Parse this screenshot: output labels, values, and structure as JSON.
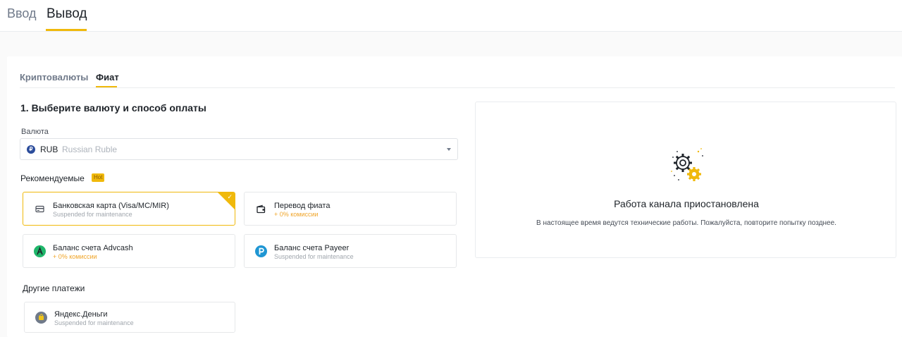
{
  "top_tabs": [
    {
      "label": "Ввод"
    },
    {
      "label": "Вывод"
    }
  ],
  "sub_tabs": [
    {
      "label": "Криптовалюты"
    },
    {
      "label": "Фиат"
    }
  ],
  "step_title": "1. Выберите валюту и способ оплаты",
  "currency": {
    "label": "Валюта",
    "symbol": "₽",
    "code": "RUB",
    "name": "Russian Ruble"
  },
  "recommended": {
    "label": "Рекомендуемые",
    "badge": "Hot",
    "methods": [
      {
        "name": "Банковская карта (Visa/MC/MIR)",
        "desc": "Suspended for maintenance",
        "icon": "bank-card-icon",
        "selected": true
      },
      {
        "name": "Перевод фиата",
        "desc": "+ 0% комиссии",
        "icon": "wallet-icon"
      },
      {
        "name": "Баланс счета Advcash",
        "desc": "+ 0% комиссии",
        "icon": "advcash-icon"
      },
      {
        "name": "Баланс счета Payeer",
        "desc": "Suspended for maintenance",
        "icon": "payeer-icon"
      }
    ]
  },
  "other": {
    "label": "Другие платежи",
    "methods": [
      {
        "name": "Яндекс.Деньги",
        "desc": "Suspended for maintenance",
        "icon": "yandex-money-icon"
      }
    ]
  },
  "status": {
    "title": "Работа канала приостановлена",
    "message": "В настоящее время ведутся технические работы. Пожалуйста, повторите попытку позднее.",
    "icon": "gears-icon"
  },
  "colors": {
    "accent": "#f0b90b",
    "commission": "#f0a529"
  }
}
